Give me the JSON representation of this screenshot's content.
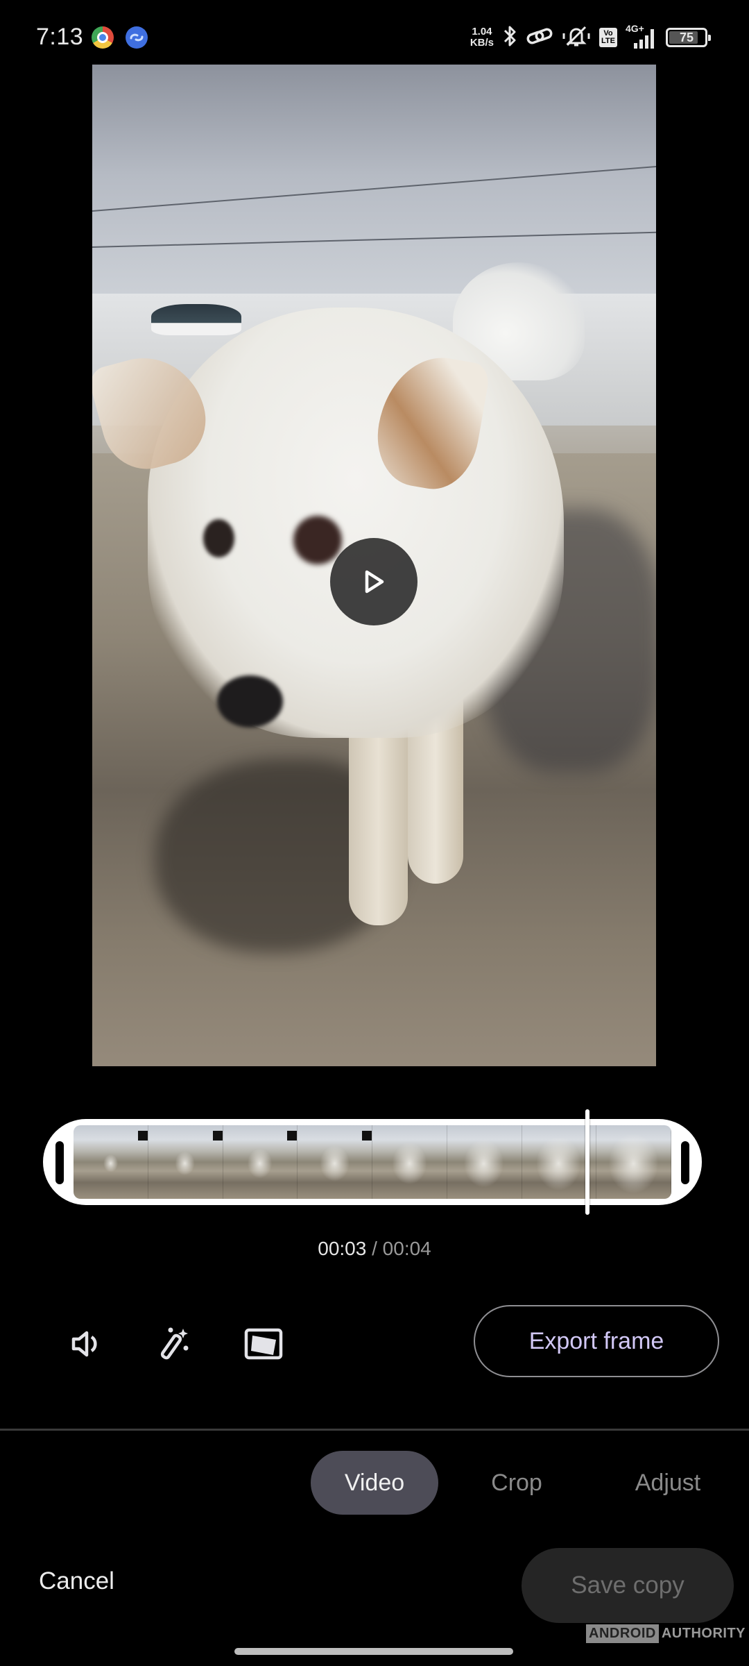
{
  "status_bar": {
    "time": "7:13",
    "notification_icons": [
      "chrome-icon",
      "link-app-icon"
    ],
    "net_speed_value": "1.04",
    "net_speed_unit": "KB/s",
    "system_icons": [
      "bluetooth-icon",
      "hotspot-link-icon",
      "silent-bell-icon",
      "volte-icon",
      "signal-icon"
    ],
    "volte_top": "Vo",
    "volte_bottom": "LTE",
    "network_type": "4G+",
    "battery_level": "75"
  },
  "preview": {
    "content": "video frame of a white dog walking toward the camera",
    "play_icon": "play-icon"
  },
  "timeline": {
    "frame_count": 8,
    "playhead_position_fraction": 0.86
  },
  "timecode": {
    "current": "00:03",
    "separator": " / ",
    "total": "00:04"
  },
  "tools": {
    "mute_icon": "volume-icon",
    "enhance_icon": "magic-wand-icon",
    "stabilize_icon": "stabilize-icon",
    "export_frame_label": "Export frame"
  },
  "tabs": [
    {
      "label": "Video",
      "selected": true
    },
    {
      "label": "Crop",
      "selected": false
    },
    {
      "label": "Adjust",
      "selected": false
    }
  ],
  "actions": {
    "cancel_label": "Cancel",
    "save_label": "Save copy"
  },
  "watermark": {
    "part1": "ANDROID",
    "part2": "AUTHORITY"
  },
  "colors": {
    "accent_text": "#d2c8f6",
    "selected_tab_bg": "#4d4c57",
    "save_button_bg": "#252525",
    "background": "#000000"
  }
}
